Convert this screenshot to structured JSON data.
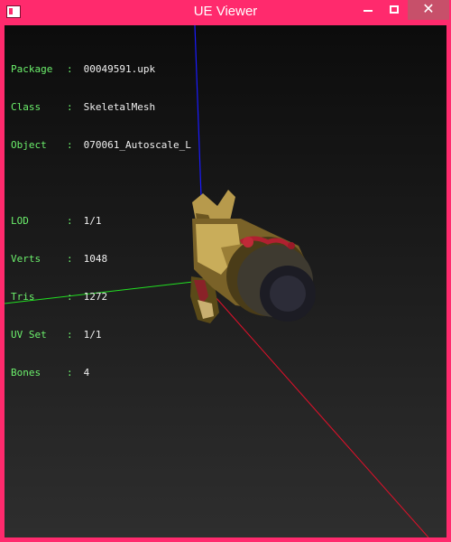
{
  "window": {
    "title": "UE Viewer",
    "controls": {
      "minimize": "minimize",
      "maximize": "maximize",
      "close": "✕"
    },
    "frame_color": "#ff2a6d"
  },
  "info_panel": {
    "rows_top": [
      {
        "label": "Package",
        "sep": ":",
        "value": "00049591.upk"
      },
      {
        "label": "Class",
        "sep": ":",
        "value": "SkeletalMesh"
      },
      {
        "label": "Object",
        "sep": ":",
        "value": "070061_Autoscale_L"
      }
    ],
    "rows_bottom": [
      {
        "label": "LOD",
        "sep": ":",
        "value": "1/1"
      },
      {
        "label": "Verts",
        "sep": ":",
        "value": "1048"
      },
      {
        "label": "Tris",
        "sep": ":",
        "value": "1272"
      },
      {
        "label": "UV Set",
        "sep": ":",
        "value": "1/1"
      },
      {
        "label": "Bones",
        "sep": ":",
        "value": "4"
      }
    ],
    "label_color": "#6cf06c",
    "value_color": "#f0f0f0"
  },
  "axes": {
    "x_color": "#e0102a",
    "y_color": "#22e022",
    "z_color": "#1a1aff"
  },
  "mesh": {
    "name": "070061_Autoscale_L"
  }
}
